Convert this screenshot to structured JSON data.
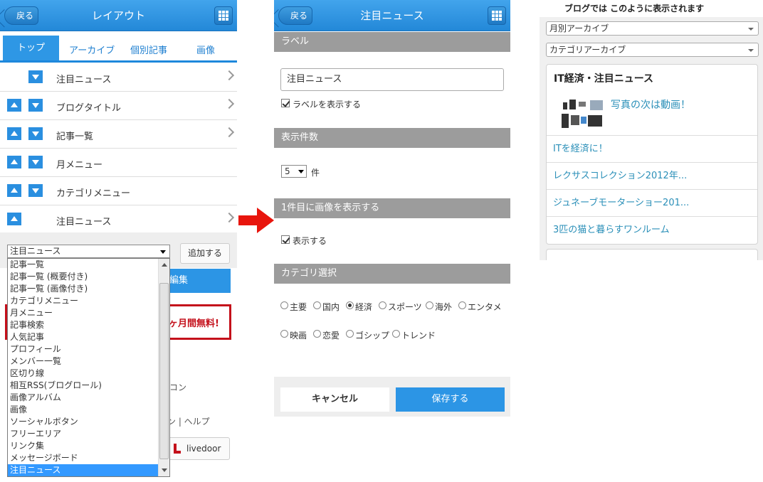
{
  "left": {
    "back_label": "戻る",
    "title": "レイアウト",
    "tabs": [
      "トップ",
      "アーカイブ",
      "個別記事",
      "画像"
    ],
    "rows": [
      {
        "label": "注目ニュース",
        "up": false,
        "down": true,
        "chevron": true
      },
      {
        "label": "ブログタイトル",
        "up": true,
        "down": true,
        "chevron": true
      },
      {
        "label": "記事一覧",
        "up": true,
        "down": true,
        "chevron": true
      },
      {
        "label": "月メニュー",
        "up": true,
        "down": true,
        "chevron": false
      },
      {
        "label": "カテゴリメニュー",
        "up": true,
        "down": true,
        "chevron": false
      },
      {
        "label": "注目ニュース",
        "up": true,
        "down": false,
        "chevron": true
      }
    ],
    "select_value": "注目ニュース",
    "add_button": "追加する",
    "edit_fragment": "編集",
    "promo_fragment": "1ヶ月間無料!",
    "dropdown_options": [
      "記事一覧",
      "記事一覧 (概要付き)",
      "記事一覧 (画像付き)",
      "カテゴリメニュー",
      "月メニュー",
      "記事検索",
      "人気記事",
      "プロフィール",
      "メンバー一覧",
      "区切り線",
      "相互RSS(ブログロール)",
      "画像アルバム",
      "画像",
      "ソーシャルボタン",
      "フリーエリア",
      "リンク集",
      "メッセージボード",
      "注目ニュース"
    ],
    "selected_option": "注目ニュース",
    "footer_fragment_1": "コン",
    "footer_fragment_2": "ン | ヘルプ",
    "livedoor": "livedoor"
  },
  "middle": {
    "back_label": "戻る",
    "title": "注目ニュース",
    "section_label": "ラベル",
    "label_value": "注目ニュース",
    "show_label": "ラベルを表示する",
    "section_count": "表示件数",
    "count_value": "5",
    "count_unit": "件",
    "section_image": "1件目に画像を表示する",
    "show_image": "表示する",
    "section_category": "カテゴリ選択",
    "categories": [
      "主要",
      "国内",
      "経済",
      "スポーツ",
      "海外",
      "エンタメ",
      "映画",
      "恋愛",
      "ゴシップ",
      "トレンド"
    ],
    "selected_category": "経済",
    "cancel": "キャンセル",
    "save": "保存する"
  },
  "right": {
    "caption": "ブログでは このように表示されます",
    "select_monthly": "月別アーカイブ",
    "select_category": "カテゴリアーカイブ",
    "card_title": "IT経済・注目ニュース",
    "first_item": "写真の次は動画！",
    "items": [
      "ITを経済に！",
      "レクサスコレクション2012年...",
      "ジュネーブモーターショー201...",
      "3匹の猫と暮らすワンルーム"
    ]
  },
  "colors": {
    "header_blue": "#2388d8",
    "accent_blue": "#2c95e5",
    "red": "#c4101b",
    "section_gray": "#9c9c9c"
  }
}
